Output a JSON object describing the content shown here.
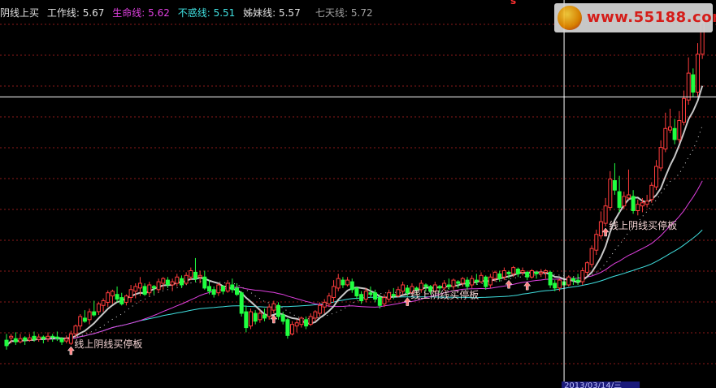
{
  "legend": {
    "title": "阴线上买",
    "work_label": "工作线:",
    "work_value": "5.67",
    "life_label": "生命线:",
    "life_value": "5.62",
    "buhuo_label": "不惑线:",
    "buhuo_value": "5.51",
    "sister_label": "姊妹线:",
    "sister_value": "5.57",
    "seven_label": "七天线:",
    "seven_value": "5.72"
  },
  "logo": {
    "text": "www.55188.com",
    "icon": "sun-logo-icon"
  },
  "top_marker": "s",
  "date_footer": "2013/03/14/三",
  "colors": {
    "background": "#000000",
    "grid": "#8b1a1a",
    "up": "#ff3c3c",
    "down": "#20ff40",
    "work_line": "#c8c8c8",
    "life_line": "#e040e0",
    "buhuo_line": "#40e0e0",
    "sister_line": "#d8d8d8",
    "signal": "#ff8080",
    "annotation_text": "#f0d0d0",
    "cursor": "#ffffff"
  },
  "chart_data": {
    "type": "candlestick",
    "annotations": [
      {
        "text": "线上阴线买停板",
        "bar": 14
      },
      {
        "text": "线上阴线买停板",
        "bar": 87
      },
      {
        "text": "线上阴线买停板",
        "bar": 130
      }
    ],
    "signal_bars": [
      14,
      58,
      87,
      109,
      113,
      130
    ],
    "cursor_bar": 121,
    "cursor_price": 6.5,
    "ylim": [
      3.0,
      7.5
    ],
    "candles": [
      [
        3.42,
        3.48,
        3.35,
        3.3,
        3.5
      ],
      [
        3.45,
        3.42,
        3.47,
        3.38,
        3.5
      ],
      [
        3.44,
        3.48,
        3.4,
        3.36,
        3.52
      ],
      [
        3.4,
        3.46,
        3.44,
        3.38,
        3.5
      ],
      [
        3.45,
        3.4,
        3.42,
        3.36,
        3.47
      ],
      [
        3.42,
        3.47,
        3.45,
        3.4,
        3.5
      ],
      [
        3.47,
        3.5,
        3.43,
        3.4,
        3.53
      ],
      [
        3.43,
        3.48,
        3.46,
        3.4,
        3.5
      ],
      [
        3.46,
        3.42,
        3.44,
        3.38,
        3.48
      ],
      [
        3.44,
        3.5,
        3.47,
        3.4,
        3.52
      ],
      [
        3.47,
        3.44,
        3.46,
        3.4,
        3.5
      ],
      [
        3.46,
        3.5,
        3.44,
        3.41,
        3.53
      ],
      [
        3.44,
        3.42,
        3.4,
        3.36,
        3.46
      ],
      [
        3.41,
        3.46,
        3.44,
        3.38,
        3.48
      ],
      [
        3.38,
        3.52,
        3.5,
        3.36,
        3.54
      ],
      [
        3.5,
        3.55,
        3.6,
        3.45,
        3.62
      ],
      [
        3.6,
        3.58,
        3.72,
        3.55,
        3.75
      ],
      [
        3.7,
        3.78,
        3.66,
        3.64,
        3.8
      ],
      [
        3.68,
        3.74,
        3.78,
        3.62,
        3.82
      ],
      [
        3.78,
        3.82,
        3.74,
        3.72,
        3.92
      ],
      [
        3.78,
        3.84,
        3.88,
        3.74,
        3.9
      ],
      [
        3.86,
        3.82,
        3.92,
        3.78,
        3.95
      ],
      [
        3.9,
        3.86,
        4.02,
        3.84,
        4.05
      ],
      [
        3.98,
        3.92,
        4.04,
        3.88,
        4.06
      ],
      [
        4.0,
        3.96,
        3.94,
        3.9,
        4.1
      ],
      [
        3.96,
        3.92,
        3.88,
        3.86,
        4.02
      ],
      [
        3.9,
        3.94,
        3.98,
        3.86,
        4.0
      ],
      [
        3.96,
        3.92,
        4.06,
        3.9,
        4.12
      ],
      [
        4.04,
        3.98,
        4.1,
        3.95,
        4.14
      ],
      [
        4.08,
        4.02,
        4.14,
        3.98,
        4.22
      ],
      [
        4.1,
        4.06,
        4.0,
        3.98,
        4.14
      ],
      [
        4.02,
        4.08,
        4.12,
        3.98,
        4.16
      ],
      [
        4.1,
        4.04,
        4.08,
        4.0,
        4.12
      ],
      [
        4.06,
        4.12,
        4.16,
        4.02,
        4.2
      ],
      [
        4.14,
        4.1,
        4.2,
        4.06,
        4.22
      ],
      [
        4.18,
        4.14,
        4.12,
        4.08,
        4.22
      ],
      [
        4.12,
        4.08,
        4.16,
        4.04,
        4.2
      ],
      [
        4.14,
        4.18,
        4.22,
        4.1,
        4.26
      ],
      [
        4.2,
        4.16,
        4.12,
        4.08,
        4.24
      ],
      [
        4.14,
        4.2,
        4.24,
        4.12,
        4.28
      ],
      [
        4.22,
        4.26,
        4.3,
        4.18,
        4.34
      ],
      [
        4.28,
        4.24,
        4.2,
        4.16,
        4.46
      ],
      [
        4.22,
        4.18,
        4.24,
        4.14,
        4.3
      ],
      [
        4.22,
        4.26,
        4.08,
        4.06,
        4.3
      ],
      [
        4.1,
        4.14,
        4.04,
        4.0,
        4.18
      ],
      [
        4.06,
        4.02,
        4.0,
        3.96,
        4.1
      ],
      [
        4.02,
        4.08,
        4.12,
        3.98,
        4.14
      ],
      [
        4.1,
        4.06,
        4.04,
        4.0,
        4.12
      ],
      [
        4.04,
        4.08,
        4.14,
        4.02,
        4.18
      ],
      [
        4.12,
        4.16,
        4.06,
        4.02,
        4.2
      ],
      [
        4.08,
        4.12,
        4.0,
        3.98,
        4.14
      ],
      [
        4.02,
        3.98,
        3.76,
        3.72,
        4.04
      ],
      [
        3.78,
        3.82,
        3.58,
        3.52,
        3.86
      ],
      [
        3.6,
        3.64,
        3.78,
        3.56,
        3.82
      ],
      [
        3.76,
        3.72,
        3.66,
        3.62,
        3.8
      ],
      [
        3.68,
        3.72,
        3.76,
        3.64,
        3.8
      ],
      [
        3.74,
        3.78,
        3.7,
        3.66,
        3.82
      ],
      [
        3.72,
        3.76,
        3.84,
        3.68,
        3.88
      ],
      [
        3.8,
        3.84,
        3.88,
        3.76,
        3.92
      ],
      [
        3.86,
        3.82,
        3.72,
        3.68,
        3.9
      ],
      [
        3.74,
        3.7,
        3.66,
        3.62,
        3.78
      ],
      [
        3.68,
        3.64,
        3.48,
        3.44,
        3.7
      ],
      [
        3.5,
        3.54,
        3.62,
        3.48,
        3.66
      ],
      [
        3.6,
        3.56,
        3.64,
        3.52,
        3.68
      ],
      [
        3.62,
        3.66,
        3.7,
        3.58,
        3.72
      ],
      [
        3.68,
        3.64,
        3.6,
        3.56,
        3.72
      ],
      [
        3.62,
        3.66,
        3.72,
        3.6,
        3.76
      ],
      [
        3.7,
        3.74,
        3.78,
        3.66,
        3.8
      ],
      [
        3.76,
        3.8,
        3.86,
        3.72,
        3.9
      ],
      [
        3.84,
        3.8,
        3.9,
        3.76,
        3.94
      ],
      [
        3.88,
        3.94,
        3.98,
        3.84,
        4.02
      ],
      [
        3.96,
        3.92,
        4.1,
        3.9,
        4.18
      ],
      [
        4.08,
        4.14,
        4.2,
        4.04,
        4.26
      ],
      [
        4.18,
        4.14,
        4.12,
        4.08,
        4.22
      ],
      [
        4.12,
        4.16,
        4.18,
        4.1,
        4.22
      ],
      [
        4.16,
        4.12,
        4.06,
        4.02,
        4.2
      ],
      [
        4.08,
        4.04,
        3.98,
        3.94,
        4.1
      ],
      [
        4.0,
        3.96,
        3.92,
        3.88,
        4.04
      ],
      [
        3.94,
        3.98,
        4.04,
        3.9,
        4.08
      ],
      [
        4.02,
        4.06,
        4.0,
        3.96,
        4.1
      ],
      [
        4.02,
        3.98,
        3.94,
        3.9,
        4.06
      ],
      [
        3.96,
        3.92,
        3.86,
        3.82,
        4.0
      ],
      [
        3.88,
        3.92,
        3.96,
        3.84,
        4.0
      ],
      [
        3.94,
        3.98,
        4.02,
        3.9,
        4.06
      ],
      [
        4.0,
        4.04,
        3.98,
        3.94,
        4.08
      ],
      [
        3.98,
        4.02,
        4.06,
        3.96,
        4.1
      ],
      [
        4.04,
        4.08,
        4.12,
        4.0,
        4.16
      ],
      [
        4.08,
        4.04,
        4.02,
        3.98,
        4.12
      ],
      [
        4.02,
        4.06,
        4.1,
        4.0,
        4.14
      ],
      [
        4.08,
        4.04,
        4.06,
        4.0,
        4.1
      ],
      [
        4.06,
        4.1,
        4.14,
        4.02,
        4.18
      ],
      [
        4.12,
        4.08,
        4.1,
        4.04,
        4.14
      ],
      [
        4.1,
        4.06,
        4.04,
        4.0,
        4.12
      ],
      [
        4.04,
        4.08,
        4.12,
        4.02,
        4.16
      ],
      [
        4.1,
        4.06,
        4.08,
        4.02,
        4.12
      ],
      [
        4.08,
        4.12,
        4.14,
        4.04,
        4.18
      ],
      [
        4.12,
        4.16,
        4.1,
        4.06,
        4.2
      ],
      [
        4.1,
        4.14,
        4.18,
        4.06,
        4.2
      ],
      [
        4.16,
        4.12,
        4.14,
        4.08,
        4.18
      ],
      [
        4.14,
        4.18,
        4.2,
        4.1,
        4.22
      ],
      [
        4.18,
        4.14,
        4.1,
        4.06,
        4.22
      ],
      [
        4.12,
        4.16,
        4.2,
        4.08,
        4.24
      ],
      [
        4.18,
        4.22,
        4.16,
        4.12,
        4.26
      ],
      [
        4.16,
        4.2,
        4.24,
        4.14,
        4.28
      ],
      [
        4.22,
        4.18,
        4.1,
        4.06,
        4.24
      ],
      [
        4.12,
        4.16,
        4.22,
        4.08,
        4.26
      ],
      [
        4.2,
        4.24,
        4.28,
        4.16,
        4.3
      ],
      [
        4.26,
        4.22,
        4.2,
        4.16,
        4.3
      ],
      [
        4.22,
        4.26,
        4.3,
        4.18,
        4.34
      ],
      [
        4.28,
        4.24,
        4.26,
        4.2,
        4.3
      ],
      [
        4.26,
        4.3,
        4.34,
        4.22,
        4.36
      ],
      [
        4.32,
        4.28,
        4.26,
        4.22,
        4.34
      ],
      [
        4.28,
        4.32,
        4.3,
        4.24,
        4.34
      ],
      [
        4.28,
        4.24,
        4.22,
        4.18,
        4.3
      ],
      [
        4.22,
        4.26,
        4.3,
        4.2,
        4.32
      ],
      [
        4.28,
        4.24,
        4.26,
        4.2,
        4.3
      ],
      [
        4.26,
        4.3,
        4.28,
        4.22,
        4.32
      ],
      [
        4.28,
        4.24,
        4.3,
        4.2,
        4.32
      ],
      [
        4.28,
        4.22,
        4.12,
        4.08,
        4.3
      ],
      [
        4.14,
        4.1,
        4.08,
        4.04,
        4.18
      ],
      [
        4.08,
        4.12,
        4.18,
        4.04,
        4.2
      ],
      [
        4.16,
        4.12,
        4.12,
        4.08,
        4.2
      ],
      [
        4.12,
        4.16,
        4.22,
        4.1,
        4.24
      ],
      [
        4.2,
        4.16,
        4.18,
        4.12,
        4.22
      ],
      [
        4.18,
        4.22,
        4.16,
        4.12,
        4.26
      ],
      [
        4.16,
        4.2,
        4.3,
        4.12,
        4.34
      ],
      [
        4.28,
        4.34,
        4.4,
        4.24,
        4.42
      ],
      [
        4.38,
        4.44,
        4.58,
        4.34,
        4.62
      ],
      [
        4.56,
        4.62,
        4.76,
        4.5,
        4.82
      ],
      [
        4.74,
        4.86,
        4.92,
        4.7,
        5.05
      ],
      [
        4.9,
        5.04,
        5.12,
        4.86,
        5.22
      ],
      [
        5.1,
        5.36,
        5.46,
        5.06,
        5.56
      ],
      [
        5.44,
        5.4,
        5.32,
        5.26,
        5.66
      ],
      [
        5.3,
        5.26,
        5.1,
        5.04,
        5.5
      ],
      [
        5.12,
        5.18,
        5.24,
        5.08,
        5.3
      ],
      [
        5.22,
        5.34,
        5.26,
        5.2,
        5.58
      ],
      [
        5.24,
        5.14,
        5.06,
        5.02,
        5.32
      ],
      [
        5.06,
        5.1,
        5.14,
        5.0,
        5.2
      ],
      [
        5.12,
        5.08,
        5.16,
        5.04,
        5.22
      ],
      [
        5.14,
        5.2,
        5.18,
        5.1,
        5.26
      ],
      [
        5.2,
        5.3,
        5.38,
        5.16,
        5.42
      ],
      [
        5.36,
        5.46,
        5.62,
        5.32,
        5.7
      ],
      [
        5.6,
        5.72,
        5.86,
        5.56,
        5.95
      ],
      [
        5.84,
        6.04,
        6.1,
        5.8,
        6.3
      ],
      [
        6.08,
        6.2,
        6.12,
        6.04,
        6.35
      ],
      [
        6.1,
        6.0,
        5.96,
        5.9,
        6.22
      ],
      [
        5.96,
        6.06,
        6.2,
        5.92,
        6.32
      ],
      [
        6.18,
        6.34,
        6.48,
        6.14,
        6.58
      ],
      [
        6.46,
        6.64,
        6.8,
        6.4,
        7.0
      ],
      [
        6.78,
        6.6,
        6.56,
        6.5,
        6.86
      ],
      [
        6.56,
        6.9,
        7.04,
        6.5,
        7.18
      ],
      [
        7.04,
        7.3,
        7.44,
        6.98,
        7.5
      ]
    ]
  }
}
